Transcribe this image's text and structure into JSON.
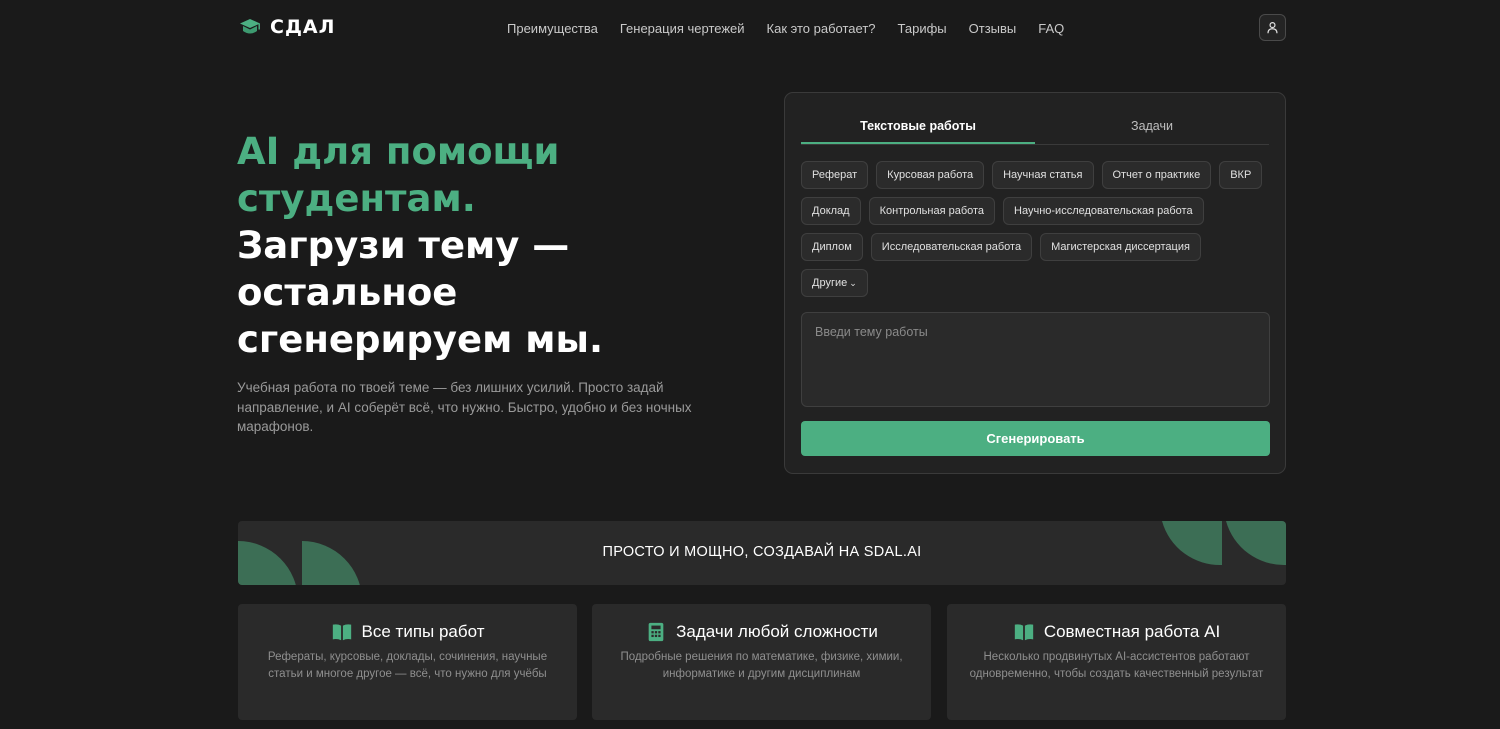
{
  "logo": {
    "text": "СДАЛ"
  },
  "nav": {
    "items": [
      "Преимущества",
      "Генерация чертежей",
      "Как это работает?",
      "Тарифы",
      "Отзывы",
      "FAQ"
    ]
  },
  "hero": {
    "title_accent_1": "AI для помощи",
    "title_accent_2": "студентам.",
    "title_main_1": "Загрузи тему —",
    "title_main_2": "остальное",
    "title_main_3": "сгенерируем мы.",
    "description": "Учебная работа по твоей теме — без лишних усилий. Просто задай направление, и AI соберёт всё, что нужно. Быстро, удобно и без ночных марафонов."
  },
  "generator": {
    "tabs": [
      "Текстовые работы",
      "Задачи"
    ],
    "active_tab": 0,
    "chips": [
      "Реферат",
      "Курсовая работа",
      "Научная статья",
      "Отчет о практике",
      "ВКР",
      "Доклад",
      "Контрольная работа",
      "Научно-исследовательская работа",
      "Диплом",
      "Исследовательская работа",
      "Магистерская диссертация"
    ],
    "more_label": "Другие",
    "topic_placeholder": "Введи тему работы",
    "topic_value": "",
    "generate_label": "Сгенерировать"
  },
  "banner": {
    "text": "ПРОСТО И МОЩНО, СОЗДАВАЙ НА SDAL.AI"
  },
  "features": [
    {
      "icon": "book-open-icon",
      "title": "Все типы работ",
      "description": "Рефераты, курсовые, доклады, сочинения, научные статьи и многое другое — всё, что нужно для учёбы"
    },
    {
      "icon": "calculator-icon",
      "title": "Задачи любой сложности",
      "description": "Подробные решения по математике, физике, химии, информатике и другим дисциплинам"
    },
    {
      "icon": "book-open-icon",
      "title": "Совместная работа AI",
      "description": "Несколько продвинутых AI-ассистентов работают одновременно, чтобы создать качественный результат"
    }
  ],
  "colors": {
    "accent": "#4caf82",
    "background": "#1a1a1a",
    "panel": "#222222",
    "card": "#2a2a2a"
  }
}
